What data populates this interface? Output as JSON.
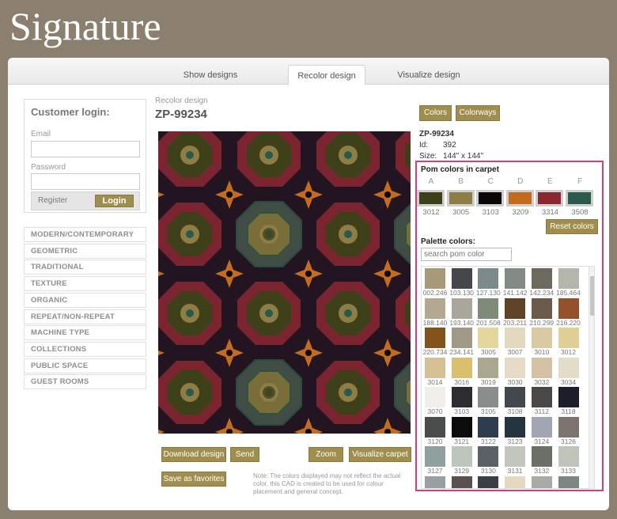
{
  "brand": "Signature",
  "tabs": [
    "Show designs",
    "Recolor design",
    "Visualize design"
  ],
  "login": {
    "title": "Customer login:",
    "email_label": "Email",
    "password_label": "Password",
    "register": "Register",
    "login_button": "Login"
  },
  "categories": [
    "MODERN/CONTEMPORARY",
    "GEOMETRIC",
    "TRADITIONAL",
    "TEXTURE",
    "ORGANIC",
    "REPEAT/NON-REPEAT",
    "MACHINE TYPE",
    "COLLECTIONS",
    "PUBLIC SPACE",
    "GUEST ROOMS"
  ],
  "design": {
    "section_label": "Recolor design",
    "code": "ZP-99234",
    "info_code": "ZP-99234",
    "id_label": "Id:",
    "id_value": "392",
    "size_label": "Size:",
    "size_value": "144\" x 144\""
  },
  "toolbar": {
    "colors": "Colors",
    "colorways": "Colorways"
  },
  "pom": {
    "title": "Pom colors in carpet",
    "letters": [
      "A",
      "B",
      "C",
      "D",
      "E",
      "F"
    ],
    "codes": [
      "3012",
      "3005",
      "3103",
      "3209",
      "3314",
      "3508"
    ],
    "colors": [
      "#3d4019",
      "#8e7d45",
      "#0b0709",
      "#c46b1e",
      "#8a2731",
      "#2a5a4b"
    ],
    "reset": "Reset colors"
  },
  "palette": {
    "title": "Palette colors:",
    "search_placeholder": "search pom color",
    "items": [
      {
        "code": "002.246",
        "color": "#a69a7a"
      },
      {
        "code": "103.130",
        "color": "#45474b"
      },
      {
        "code": "127.130",
        "color": "#7c8a8c"
      },
      {
        "code": "141.142",
        "color": "#828b83"
      },
      {
        "code": "142.234",
        "color": "#6c6a5c"
      },
      {
        "code": "185.464",
        "color": "#b4b5ac"
      },
      {
        "code": "188.140",
        "color": "#b3a891"
      },
      {
        "code": "193.140",
        "color": "#a9a69c"
      },
      {
        "code": "201.508",
        "color": "#7f8b78"
      },
      {
        "code": "203.211",
        "color": "#5f4326"
      },
      {
        "code": "210.299",
        "color": "#6a5a4b"
      },
      {
        "code": "216.220",
        "color": "#94522a"
      },
      {
        "code": "220.734",
        "color": "#82541c"
      },
      {
        "code": "234.141",
        "color": "#9e9a86"
      },
      {
        "code": "3005",
        "color": "#e3d79e"
      },
      {
        "code": "3007",
        "color": "#e2d8bd"
      },
      {
        "code": "3010",
        "color": "#d9c9a2"
      },
      {
        "code": "3012",
        "color": "#dfcf95"
      },
      {
        "code": "3014",
        "color": "#d6c197"
      },
      {
        "code": "3016",
        "color": "#d9c070"
      },
      {
        "code": "3019",
        "color": "#a9a790"
      },
      {
        "code": "3030",
        "color": "#e4dac6"
      },
      {
        "code": "3032",
        "color": "#d4c1a6"
      },
      {
        "code": "3034",
        "color": "#e2dcc9"
      },
      {
        "code": "3070",
        "color": "#f1efea"
      },
      {
        "code": "3103",
        "color": "#2c2d30"
      },
      {
        "code": "3105",
        "color": "#8a8d8c"
      },
      {
        "code": "3108",
        "color": "#43474e"
      },
      {
        "code": "3112",
        "color": "#4a4846"
      },
      {
        "code": "3118",
        "color": "#1c1f2b"
      },
      {
        "code": "3120",
        "color": "#4b4d4c"
      },
      {
        "code": "3121",
        "color": "#0d0c0d"
      },
      {
        "code": "3122",
        "color": "#2e3d4d"
      },
      {
        "code": "3123",
        "color": "#24353f"
      },
      {
        "code": "3124",
        "color": "#a1a6b2"
      },
      {
        "code": "3126",
        "color": "#7c7370"
      },
      {
        "code": "3127",
        "color": "#8fa09e"
      },
      {
        "code": "3129",
        "color": "#bcc6bb"
      },
      {
        "code": "3130",
        "color": "#5b6067"
      },
      {
        "code": "3131",
        "color": "#c3c6be"
      },
      {
        "code": "3132",
        "color": "#6a7068"
      },
      {
        "code": "3133",
        "color": "#c0c5bc"
      },
      {
        "code": "",
        "color": "#9aa0a2"
      },
      {
        "code": "",
        "color": "#59504f"
      },
      {
        "code": "",
        "color": "#3b3e45"
      },
      {
        "code": "",
        "color": "#e3d8c0"
      },
      {
        "code": "",
        "color": "#a7aaa5"
      },
      {
        "code": "",
        "color": "#7d8680"
      }
    ]
  },
  "actions": {
    "download": "Download design",
    "send": "Send",
    "zoom": "Zoom",
    "visualize": "Visualize carpet",
    "favorites": "Save as favorites"
  },
  "note": "Note: The colors displayed may not reflect the actual color, this CAD is created to be used for colour placement and general concept."
}
